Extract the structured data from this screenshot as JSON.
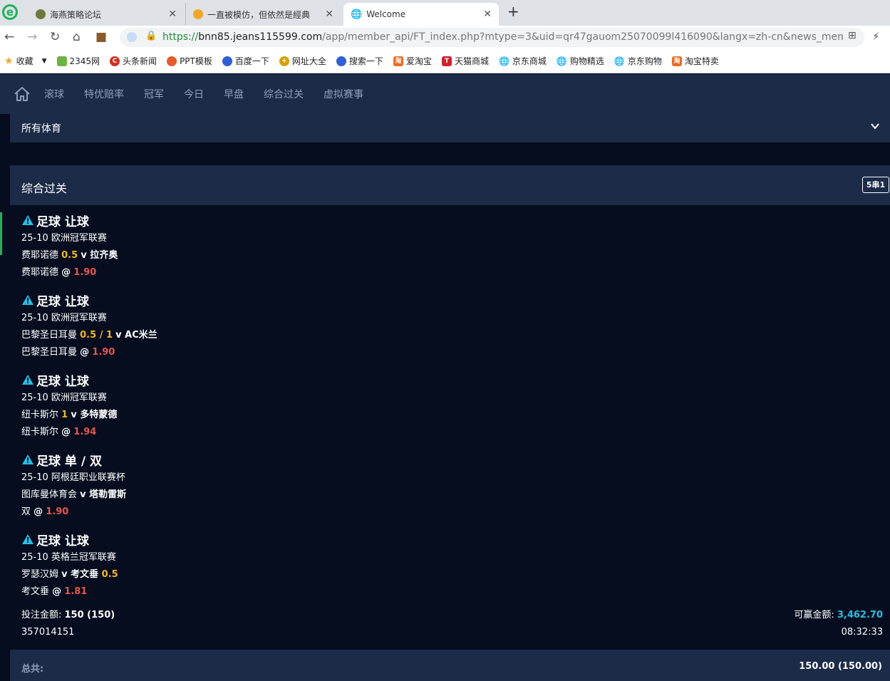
{
  "browser": {
    "tabs": [
      {
        "title": "海燕策略论坛",
        "color": "#6a7a3c"
      },
      {
        "title": "一直被模仿，但依然是經典",
        "color": "#f5a623"
      },
      {
        "title": "Welcome",
        "color": "#888888"
      }
    ],
    "url_scheme": "https://",
    "url_host": "bnn85.jeans115599.com",
    "url_path": "/app/member_api/FT_index.php?mtype=3&uid=qr47gauom25070099l416090&langx=zh-cn&news_mem=Y&ne",
    "bookmarks": [
      {
        "label": "收藏",
        "color": "#f5a623"
      },
      {
        "label": "2345网",
        "color": "#6db33f"
      },
      {
        "label": "头条新闻",
        "color": "#d52b1e"
      },
      {
        "label": "PPT模板",
        "color": "#e85a2a"
      },
      {
        "label": "百度一下",
        "color": "#2f5fd8"
      },
      {
        "label": "网址大全",
        "color": "#d4a20a"
      },
      {
        "label": "搜索一下",
        "color": "#2f5fd8"
      },
      {
        "label": "爱淘宝",
        "color": "#f06a1f"
      },
      {
        "label": "天猫商城",
        "color": "#d51f2b"
      },
      {
        "label": "京东商城",
        "color": "#888888"
      },
      {
        "label": "购物精选",
        "color": "#888888"
      },
      {
        "label": "京东购物",
        "color": "#888888"
      },
      {
        "label": "淘宝特卖",
        "color": "#f06a1f"
      }
    ]
  },
  "nav": {
    "items": [
      "滚球",
      "特优赔率",
      "冠军",
      "今日",
      "早盘",
      "综合过关",
      "虚拟赛事"
    ]
  },
  "sports_filter": {
    "label": "所有体育"
  },
  "parlay": {
    "title": "综合过关",
    "badge": "5串1"
  },
  "bets": [
    {
      "title": "足球 让球",
      "league": "25-10 欧洲冠军联赛",
      "home": "费耶诺德 ",
      "home_hl": "0.5",
      "vs": "v 拉齐奥",
      "away_hl": "",
      "selection": "费耶诺德 ",
      "odds": "1.90"
    },
    {
      "title": "足球 让球",
      "league": "25-10 欧洲冠军联赛",
      "home": "巴黎圣日耳曼 ",
      "home_hl": "0.5 / 1",
      "vs": "v AC米兰",
      "away_hl": "",
      "selection": "巴黎圣日耳曼 ",
      "odds": "1.90"
    },
    {
      "title": "足球 让球",
      "league": "25-10 欧洲冠军联赛",
      "home": "纽卡斯尔 ",
      "home_hl": "1",
      "vs": "v 多特蒙德",
      "away_hl": "",
      "selection": "纽卡斯尔 ",
      "odds": "1.94"
    },
    {
      "title": "足球 单 / 双",
      "league": "25-10 阿根廷职业联赛杯",
      "home": "图库曼体育会 ",
      "home_hl": "",
      "vs": "v 塔勒雷斯",
      "away_hl": "",
      "selection": "双 ",
      "odds": "1.90"
    },
    {
      "title": "足球 让球",
      "league": "25-10 英格兰冠军联赛",
      "home": "罗瑟汉姆 ",
      "home_hl": "",
      "vs": "v 考文垂 ",
      "away_hl": "0.5",
      "selection": "考文垂 ",
      "odds": "1.81"
    }
  ],
  "summary": {
    "stake_label": "投注金额: ",
    "stake_value": "150 (150)",
    "win_label": "可赢金额: ",
    "win_value": "3,462.70",
    "ticket_id": "357014151",
    "time": "08:32:33"
  },
  "total": {
    "label": "总共:",
    "value": "150.00 (150.00)"
  }
}
